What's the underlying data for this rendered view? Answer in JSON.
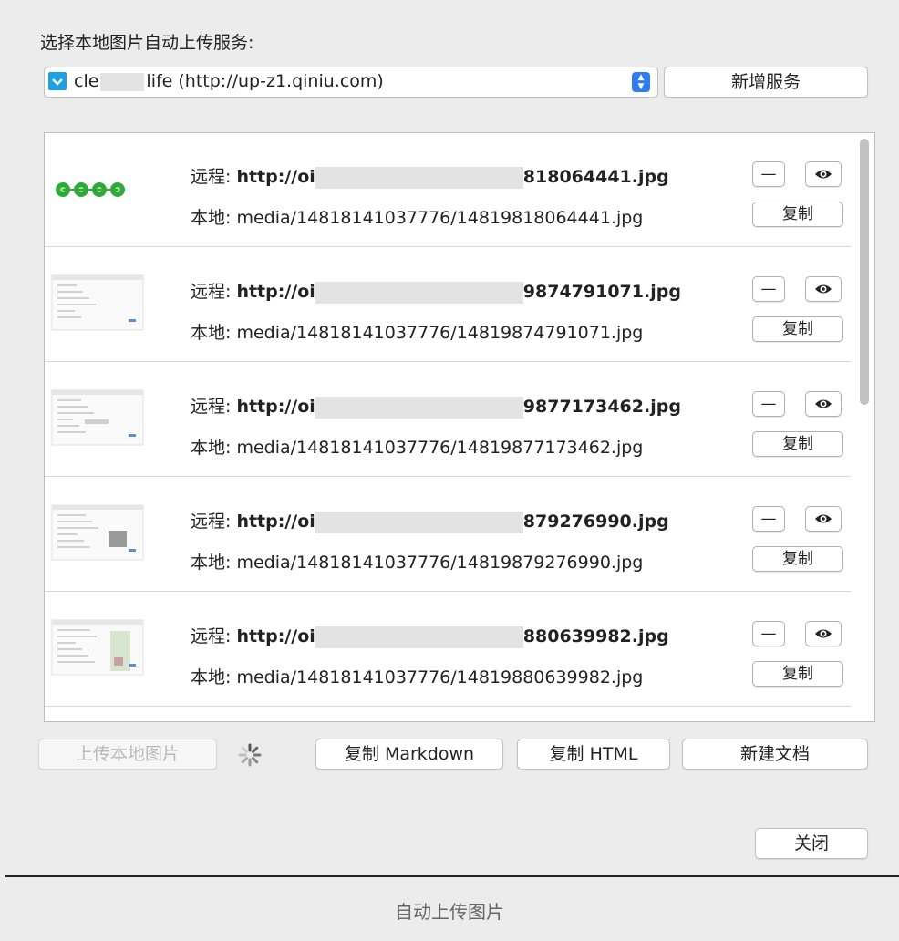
{
  "dialog": {
    "select_label": "选择本地图片自动上传服务:",
    "service": {
      "name_prefix": "cle",
      "name_suffix": "life (http://up-z1.qiniu.com)",
      "icon": "qiniu-service-icon"
    },
    "add_service_label": "新增服务",
    "remote_label": "远程:",
    "local_label": "本地:",
    "remote_prefix": "http://oi",
    "copy_label": "复制",
    "minus_label": "—",
    "items": [
      {
        "remote_suffix": "818064441.jpg",
        "local": "media/14818141037776/14819818064441.jpg",
        "thumb": "green-dots"
      },
      {
        "remote_suffix": "9874791071.jpg",
        "local": "media/14818141037776/14819874791071.jpg",
        "thumb": "screenshot"
      },
      {
        "remote_suffix": "9877173462.jpg",
        "local": "media/14818141037776/14819877173462.jpg",
        "thumb": "screenshot"
      },
      {
        "remote_suffix": "879276990.jpg",
        "local": "media/14818141037776/14819879276990.jpg",
        "thumb": "screenshot"
      },
      {
        "remote_suffix": "880639982.jpg",
        "local": "media/14818141037776/14819880639982.jpg",
        "thumb": "screenshot"
      }
    ],
    "upload_local_label": "上传本地图片",
    "copy_markdown_label": "复制 Markdown",
    "copy_html_label": "复制 HTML",
    "new_doc_label": "新建文档",
    "close_label": "关闭"
  },
  "caption": "自动上传图片",
  "colors": {
    "accent": "#2f7df6",
    "service_icon": "#1ea0e6",
    "dots_green": "#2eaa3a"
  }
}
